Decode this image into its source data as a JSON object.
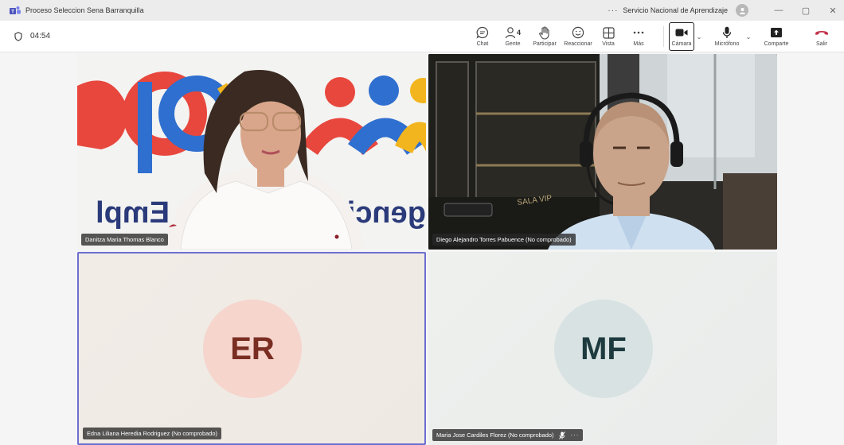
{
  "window": {
    "title": "Proceso Seleccion Sena Barranquilla",
    "more": "···",
    "organization": "Servicio Nacional de Aprendizaje",
    "minimize": "—",
    "restore": "▢",
    "close": "✕"
  },
  "toolbar": {
    "timer": "04:54",
    "chat_label": "Chat",
    "people_label": "Gente",
    "people_count": "4",
    "raise_label": "Participar",
    "react_label": "Reaccionar",
    "view_label": "Vista",
    "more_label": "Más",
    "camera_label": "Cámara",
    "mic_label": "Micrófono",
    "share_label": "Comparte",
    "leave_label": "Salir",
    "chevron": "⌄"
  },
  "participants": [
    {
      "name": "Danitza Maria Thomas Blanco"
    },
    {
      "name": "Diego Alejandro Torres Pabuence (No comprobado)"
    },
    {
      "name": "Edna Liliana Heredia Rodriguez (No comprobado)",
      "initials": "ER"
    },
    {
      "name": "Maria Jose Cardiles Florez (No comprobado)",
      "initials": "MF",
      "muted": true,
      "more": "···"
    }
  ],
  "backdrop_text": {
    "left": "Empl",
    "right": "genci",
    "sign": "SALA VIP"
  },
  "colors": {
    "accent": "#6b6fd0",
    "leave": "#c4314b",
    "initials_er_bg": "#f6d5cd",
    "initials_mf_bg": "#d8e2e2"
  }
}
